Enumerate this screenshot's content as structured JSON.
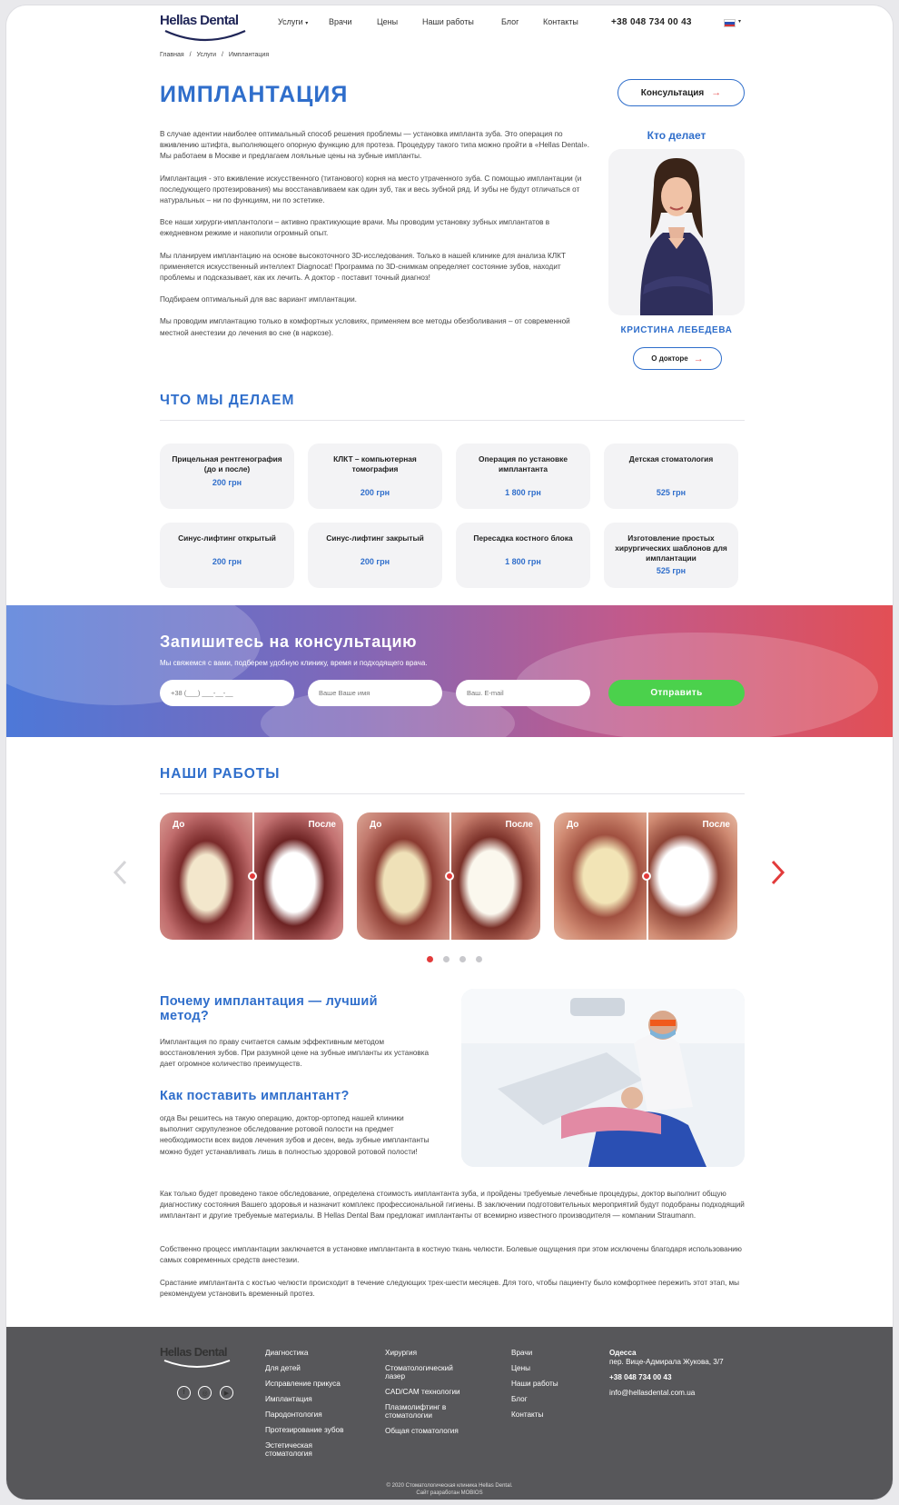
{
  "header": {
    "logo": "Hellas Dental",
    "nav": [
      "Услуги",
      "Врачи",
      "Цены",
      "Наши работы",
      "Блог",
      "Контакты"
    ],
    "phone": "+38 048 734 00 43"
  },
  "breadcrumbs": [
    "Главная",
    "/",
    "Услуги",
    "/",
    "Имплантация"
  ],
  "page_title": "ИМПЛАНТАЦИЯ",
  "consult_button": "Консультация",
  "intro": [
    "В случае адентии наиболее оптимальный способ решения проблемы — установка импланта зуба. Это операция по вживлению штифта, выполняющего опорную функцию для протеза. Процедуру такого типа можно пройти в «Hellas Dental». Мы работаем в Москве и предлагаем лояльные цены на зубные импланты.",
    "Имплантация - это вживление искусственного (титанового) корня на место утраченного зуба. С помощью имплантации (и последующего протезирования) мы восстанавливаем как один зуб, так и весь зубной ряд. И зубы не будут отличаться от натуральных – ни по функциям, ни по эстетике.",
    "Все наши хирурги-имплантологи – активно практикующие врачи. Мы проводим установку зубных имплантатов в ежедневном режиме и накопили огромный опыт.",
    "Мы планируем имплантацию на основе высокоточного 3D-исследования. Только в нашей клинике для анализа КЛКТ применяется искусственный интеллект Diagnocat! Программа по 3D-снимкам определяет состояние зубов, находит проблемы и подсказывает, как их лечить. А доктор - поставит точный диагноз!",
    "Подбираем оптимальный для вас вариант имплантации.",
    "Мы проводим имплантацию только в комфортных условиях, применяем все методы обезболивания – от современной местной анестезии до лечения во сне (в наркозе)."
  ],
  "doctor": {
    "section_title": "Кто делает",
    "name": "КРИСТИНА ЛЕБЕДЕВА",
    "button": "О докторе"
  },
  "services": {
    "title": "ЧТО МЫ ДЕЛАЕМ",
    "items": [
      {
        "name": "Прицельная рентгенография (до и после)",
        "price": "200 грн"
      },
      {
        "name": "КЛКТ – компьютерная томография",
        "price": "200 грн"
      },
      {
        "name": "Операция по установке имплантанта",
        "price": "1 800 грн"
      },
      {
        "name": "Детская стоматология",
        "price": "525 грн"
      },
      {
        "name": "Синус-лифтинг открытый",
        "price": "200 грн"
      },
      {
        "name": "Синус-лифтинг закрытый",
        "price": "200 грн"
      },
      {
        "name": "Пересадка костного блока",
        "price": "1 800 грн"
      },
      {
        "name": "Изготовление простых хирургических шаблонов для имплантации",
        "price": "525 грн"
      }
    ]
  },
  "consult_form": {
    "title": "Запишитесь на консультацию",
    "subtitle": "Мы свяжемся с вами, подберем удобную клинику, время и подходящего врача.",
    "phone_placeholder": "+38 (___) ___-__-__",
    "name_placeholder": "Ваше Ваше имя",
    "email_placeholder": "Ваш. E-mail",
    "submit": "Отправить"
  },
  "works": {
    "title": "НАШИ РАБОТЫ",
    "before": "До",
    "after": "После",
    "active_dot": 1,
    "dot_count": 4
  },
  "article": {
    "h_why": "Почему имплантация — лучший метод?",
    "p_why": "Имплантация по праву считается самым эффективным методом восстановления зубов. При разумной цене на зубные импланты их установка дает огромное количество преимуществ.",
    "h_how": "Как поставить имплантант?",
    "p_how": "огда Вы решитесь на такую операцию, доктор-ортопед нашей клиники выполнит скрупулезное обследование ротовой полости на предмет необходимости всех видов лечения зубов и десен, ведь зубные имплантанты можно будет устанавливать лишь в полностью здоровой ротовой полости!",
    "p1": "Как только будет проведено такое обследование, определена стоимость имплантанта зуба, и пройдены требуемые лечебные процедуры, доктор выполнит общую диагностику состояния Вашего здоровья и назначит комплекс профессиональной гигиены. В заключении подготовительных мероприятий будут подобраны подходящий имплантант и другие требуемые материалы. В Hellas Dental Вам предложат имплантанты от всемирно известного производителя — компании Straumann.",
    "p2": "Собственно процесс имплантации заключается в установке имплантанта в костную ткань челюсти. Болевые ощущения при этом исключены благодаря использованию самых современных средств анестезии.",
    "p3": "Срастание имплантанта с костью челюсти происходит в течение следующих трех-шести месяцев. Для того, чтобы пациенту было комфортнее пережить этот этап, мы рекомендуем установить временный протез."
  },
  "footer": {
    "logo": "Hellas Dental",
    "col1": [
      "Диагностика",
      "Для детей",
      "Исправление прикуса",
      "Имплантация",
      "Пародонтология",
      "Протезирование зубов",
      "Эстетическая стоматология"
    ],
    "col2": [
      "Хирургия",
      "Стоматологический лазер",
      "CAD/CAM технологии",
      "Плазмолифтинг в стоматологии",
      "Общая стоматология"
    ],
    "col3": [
      "Врачи",
      "Цены",
      "Наши работы",
      "Блог",
      "Контакты"
    ],
    "city": "Одесса",
    "address": "пер. Вице-Адмирала Жукова, 3/7",
    "phone": "+38 048 734 00 43",
    "email": "info@hellasdental.com.ua",
    "copyright": "© 2020 Стоматологическая клиника Hellas Dental.",
    "developer": "Сайт разработан MOBIOS"
  }
}
